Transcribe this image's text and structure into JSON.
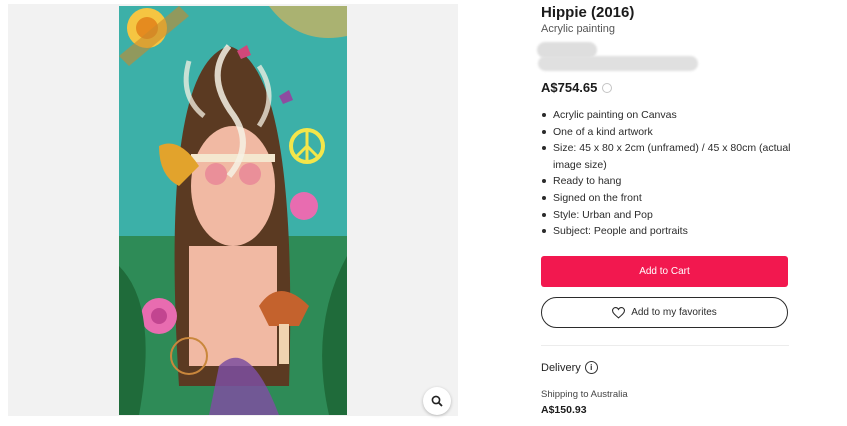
{
  "product": {
    "title": "Hippie (2016)",
    "subtitle": "Acrylic painting",
    "price": "A$754.65",
    "features": [
      "Acrylic painting on Canvas",
      "One of a kind artwork",
      "Size: 45 x 80 x 2cm (unframed) / 45 x 80cm (actual image size)",
      "Ready to hang",
      "Signed on the front",
      "Style: Urban and Pop",
      "Subject: People and portraits"
    ]
  },
  "actions": {
    "add_to_cart": "Add to Cart",
    "add_to_favorites": "Add to my favorites"
  },
  "delivery": {
    "heading": "Delivery",
    "shipping_label": "Shipping to Australia",
    "shipping_price": "A$150.93"
  },
  "colors": {
    "cart_button": "#f2184f",
    "painting_background": "#3cb0a8"
  },
  "icons": [
    "zoom-icon",
    "heart-icon",
    "info-icon"
  ]
}
